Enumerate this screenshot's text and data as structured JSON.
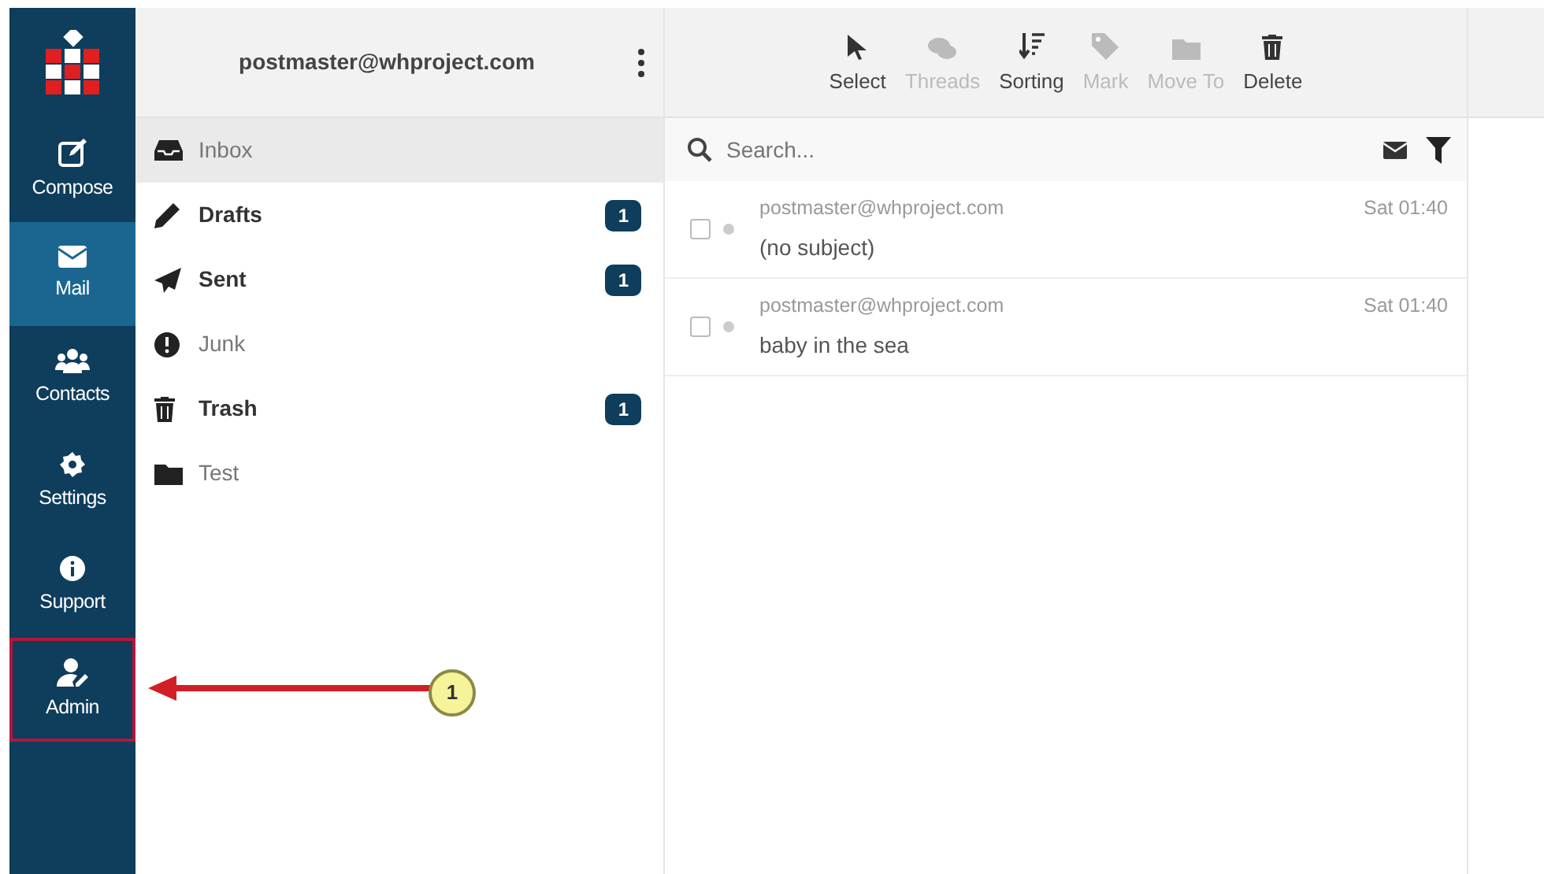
{
  "account": {
    "email": "postmaster@whproject.com"
  },
  "nav": [
    {
      "label": "Compose",
      "selected": false,
      "annotated": false
    },
    {
      "label": "Mail",
      "selected": true,
      "annotated": false
    },
    {
      "label": "Contacts",
      "selected": false,
      "annotated": false
    },
    {
      "label": "Settings",
      "selected": false,
      "annotated": false
    },
    {
      "label": "Support",
      "selected": false,
      "annotated": false
    },
    {
      "label": "Admin",
      "selected": false,
      "annotated": true
    }
  ],
  "folders": [
    {
      "name": "Inbox",
      "selected": true,
      "unread": false
    },
    {
      "name": "Drafts",
      "selected": false,
      "unread": true,
      "count": "1"
    },
    {
      "name": "Sent",
      "selected": false,
      "unread": true,
      "count": "1"
    },
    {
      "name": "Junk",
      "selected": false,
      "unread": false
    },
    {
      "name": "Trash",
      "selected": false,
      "unread": true,
      "count": "1"
    },
    {
      "name": "Test",
      "selected": false,
      "unread": false
    }
  ],
  "toolbar": [
    {
      "label": "Select",
      "disabled": false
    },
    {
      "label": "Threads",
      "disabled": true
    },
    {
      "label": "Sorting",
      "disabled": false
    },
    {
      "label": "Mark",
      "disabled": true
    },
    {
      "label": "Move To",
      "disabled": true
    },
    {
      "label": "Delete",
      "disabled": false
    }
  ],
  "search": {
    "placeholder": "Search..."
  },
  "messages": [
    {
      "sender": "postmaster@whproject.com",
      "time": "Sat 01:40",
      "subject": "(no subject)",
      "checked": false
    },
    {
      "sender": "postmaster@whproject.com",
      "time": "Sat 01:40",
      "subject": "baby in the sea",
      "checked": false
    }
  ],
  "annotation": {
    "number": "1"
  }
}
